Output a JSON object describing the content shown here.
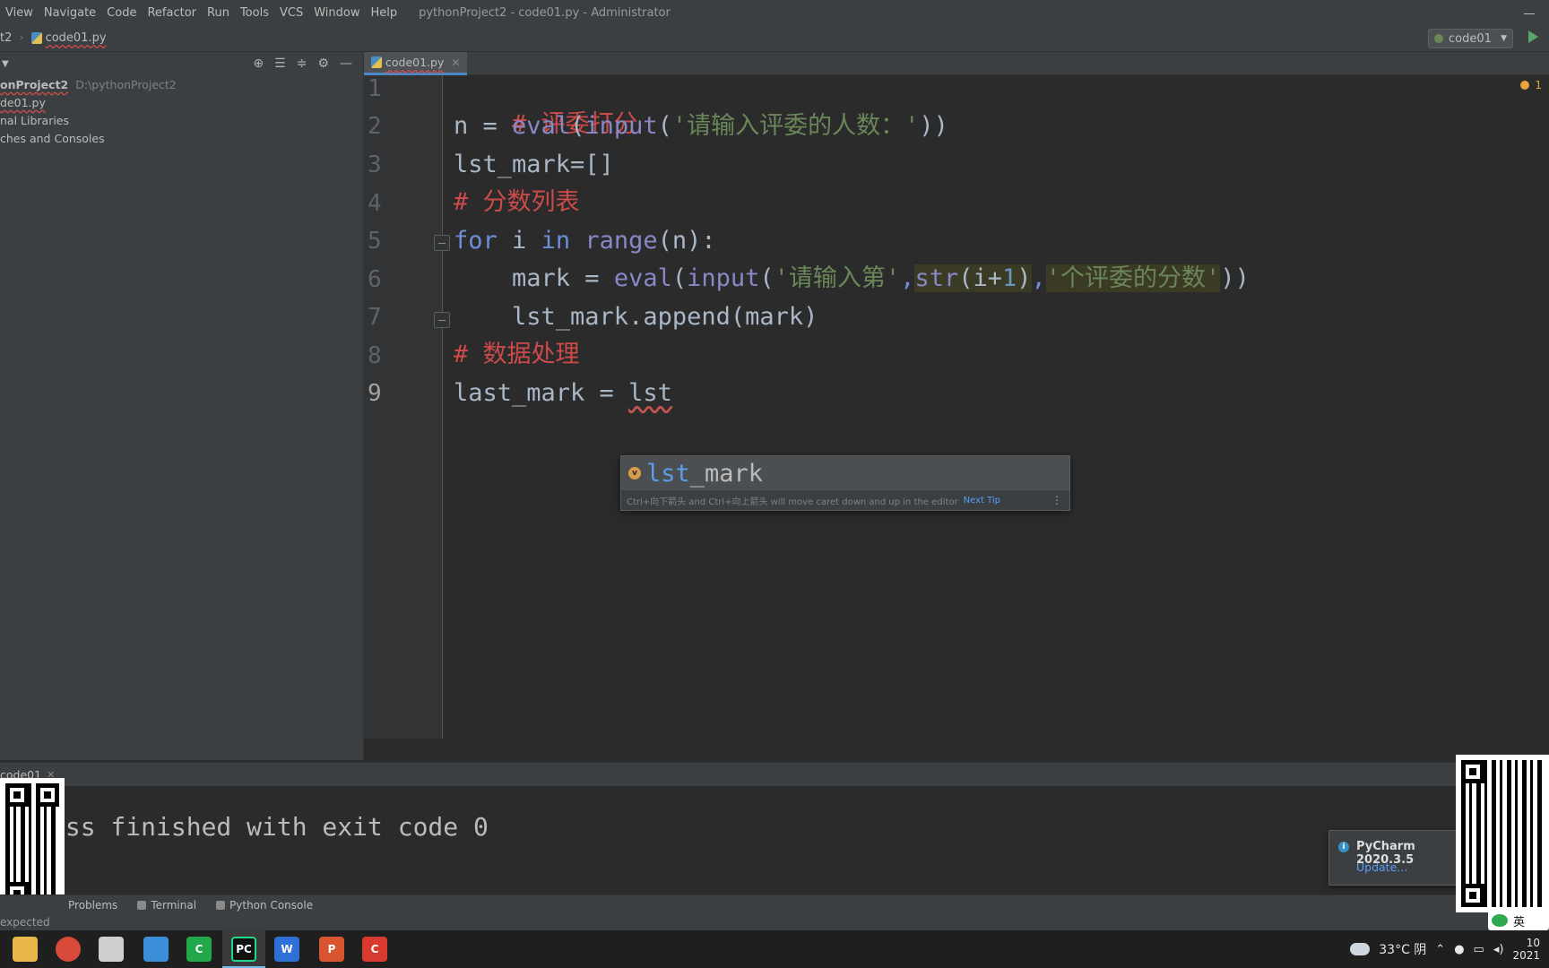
{
  "menubar": {
    "items": [
      "View",
      "Navigate",
      "Code",
      "Refactor",
      "Run",
      "Tools",
      "VCS",
      "Window",
      "Help"
    ],
    "title": "pythonProject2 - code01.py - Administrator"
  },
  "navbar": {
    "project": "t2",
    "file": "code01.py",
    "run_config": "code01"
  },
  "project_panel": {
    "root_name": "onProject2",
    "root_path": "D:\\pythonProject2",
    "file": "de01.py",
    "external_libraries": "nal Libraries",
    "scratches": "ches and Consoles"
  },
  "editor": {
    "tab_label": "code01.py",
    "inspection_count": "1",
    "line_numbers": [
      "1",
      "2",
      "3",
      "4",
      "5",
      "6",
      "7",
      "8",
      "9"
    ],
    "lines": {
      "l1_comment": "# 评委打分",
      "l2_a": "n = ",
      "l2_eval": "eval",
      "l2_b": "(",
      "l2_input": "input",
      "l2_c": "(",
      "l2_str": "'请输入评委的人数：'",
      "l2_d": "))",
      "l3": "lst_mark=[]",
      "l4_comment": "# 分数列表",
      "l5_for": "for",
      "l5_i": " i ",
      "l5_in": "in",
      "l5_sp": " ",
      "l5_range": "range",
      "l5_rest": "(n):",
      "l6_a": "    mark = ",
      "l6_eval": "eval",
      "l6_b": "(",
      "l6_input": "input",
      "l6_c": "(",
      "l6_str1": "'请输入第'",
      "l6_comma1": ",",
      "l6_str": "str",
      "l6_d": "(i+",
      "l6_num": "1",
      "l6_e": ")",
      "l6_comma2": ",",
      "l6_str2": "'个评委的分数'",
      "l6_f": "))",
      "l7": "    lst_mark.append(mark)",
      "l8_comment": "# 数据处理",
      "l9_a": "last_mark = ",
      "l9_b": "lst"
    }
  },
  "completion": {
    "icon_letter": "v",
    "match": "lst",
    "rest": "_mark",
    "hint": "Ctrl+向下箭头 and Ctrl+向上箭头 will move caret down and up in the editor",
    "next_tip": "Next Tip"
  },
  "run_panel": {
    "tab": "code01",
    "output": "ess finished with exit code 0"
  },
  "toolwindows": {
    "problems": "Problems",
    "terminal": "Terminal",
    "python_console": "Python Console"
  },
  "status": {
    "message": "expected"
  },
  "notification": {
    "title": "PyCharm 2020.3.5",
    "link": "Update..."
  },
  "taskbar": {
    "weather": "33°C 阴",
    "ime": "英",
    "clock_time": "10",
    "clock_date": "2021"
  },
  "colors": {
    "accent": "#4a88c7",
    "comment": "#cc4a4a",
    "keyword": "#6e8fd8",
    "string": "#6a8759",
    "number": "#6897bb"
  }
}
